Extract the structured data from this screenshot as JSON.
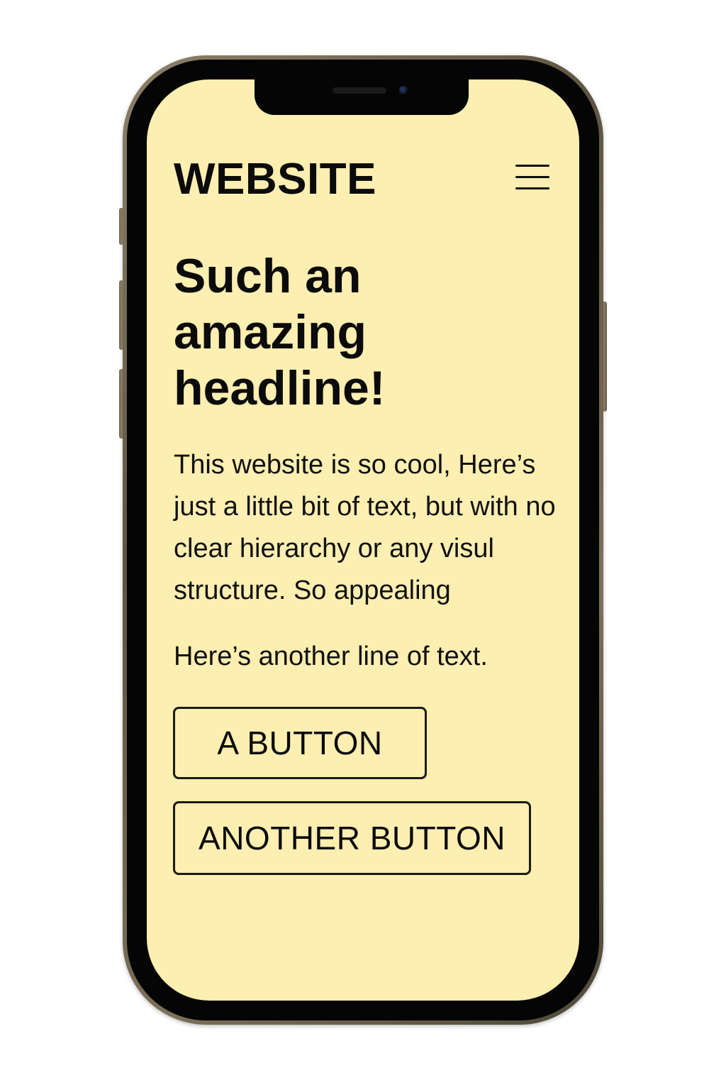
{
  "site": {
    "logo": "WEBSITE",
    "menu_icon": "hamburger-menu-icon",
    "background_color": "#fdeeb1"
  },
  "hero": {
    "headline": "Such an amazing headline!",
    "paragraph": "This website is so cool, Here’s just a little bit of text, but with no clear hierarchy or any visul structure. So appealing",
    "secondary_text": "Here’s another line of text."
  },
  "buttons": {
    "primary_label": "A BUTTON",
    "secondary_label": "ANOTHER BUTTON"
  },
  "device": {
    "frame_color": "#7c7058",
    "notch_icons": [
      "speaker-grille-icon",
      "front-camera-icon"
    ]
  }
}
